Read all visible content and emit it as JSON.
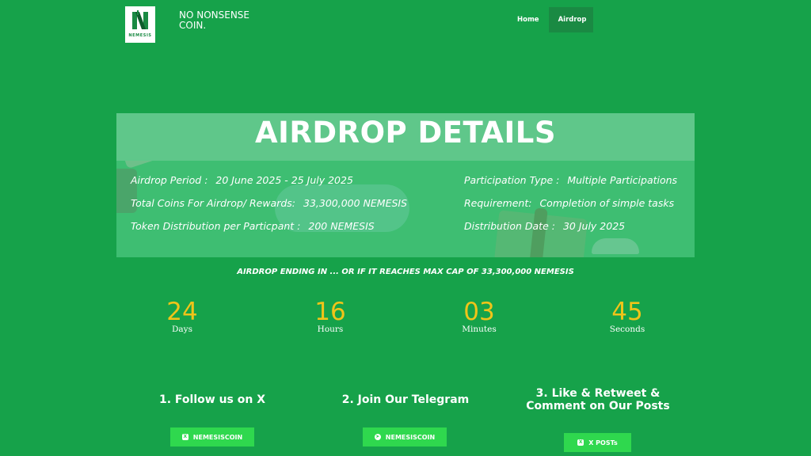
{
  "header": {
    "logo_word": "NEMESIS",
    "tagline": "NO NONSENSE COIN.",
    "nav": [
      {
        "label": "Home",
        "active": false
      },
      {
        "label": "Airdrop",
        "active": true
      }
    ]
  },
  "banner": {
    "title": "AIRDROP DETAILS",
    "left_details": [
      {
        "label": "Airdrop Period :",
        "value": "20 June 2025 - 25 July 2025"
      },
      {
        "label": "Total Coins For Airdrop/ Rewards:",
        "value": "33,300,000 NEMESIS"
      },
      {
        "label": "Token Distribution per Particpant  :",
        "value": "200 NEMESIS"
      }
    ],
    "right_details": [
      {
        "label": "Participation Type :",
        "value": "Multiple Participations"
      },
      {
        "label": "Requirement:",
        "value": "Completion of simple tasks"
      },
      {
        "label": "Distribution Date :",
        "value": "30 July 2025"
      }
    ]
  },
  "countdown": {
    "heading": "AIRDROP ENDING IN ... OR IF IT REACHES MAX CAP OF 33,300,000 NEMESIS",
    "units": [
      {
        "value": "24",
        "label": "Days"
      },
      {
        "value": "16",
        "label": "Hours"
      },
      {
        "value": "03",
        "label": "Minutes"
      },
      {
        "value": "45",
        "label": "Seconds"
      }
    ]
  },
  "steps": [
    {
      "title": "1. Follow us on X",
      "button": "NEMESISCOIN",
      "icon": "x-icon"
    },
    {
      "title": "2. Join Our Telegram",
      "button": "NEMESISCOIN",
      "icon": "telegram-icon"
    },
    {
      "title": "3. Like & Retweet & Comment on Our Posts",
      "button": "X POSTs",
      "icon": "x-icon"
    }
  ],
  "colors": {
    "background": "#16a24a",
    "accent_number": "#f0c419",
    "button": "#2fd84e",
    "nav_active": "#1a8a43"
  }
}
